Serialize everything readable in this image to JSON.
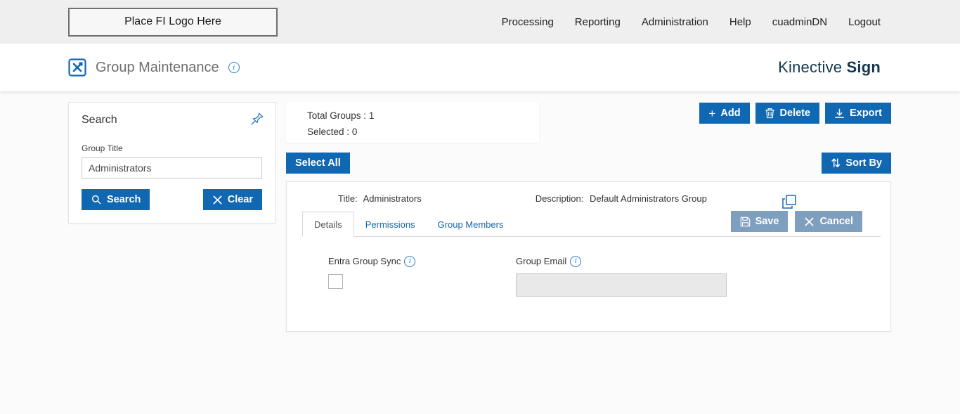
{
  "topbar": {
    "logo_placeholder": "Place FI Logo Here",
    "nav": [
      {
        "label": "Processing"
      },
      {
        "label": "Reporting"
      },
      {
        "label": "Administration"
      },
      {
        "label": "Help"
      },
      {
        "label": "cuadminDN"
      },
      {
        "label": "Logout"
      }
    ]
  },
  "header": {
    "title": "Group Maintenance",
    "brand_regular": "Kinective ",
    "brand_bold": "Sign"
  },
  "search_panel": {
    "title": "Search",
    "group_title_label": "Group Title",
    "group_title_value": "Administrators",
    "search_button": "Search",
    "clear_button": "Clear"
  },
  "summary": {
    "total_groups_label": "Total Groups :",
    "total_groups_value": "1",
    "selected_label": "Selected :",
    "selected_value": "0"
  },
  "toolbar": {
    "add": "Add",
    "delete": "Delete",
    "export": "Export",
    "select_all": "Select All",
    "sort_by": "Sort By"
  },
  "group_card": {
    "title_label": "Title:",
    "title_value": "Administrators",
    "description_label": "Description:",
    "description_value": "Default Administrators Group",
    "tabs": [
      {
        "label": "Details"
      },
      {
        "label": "Permissions"
      },
      {
        "label": "Group Members"
      }
    ],
    "active_tab": "Details",
    "save_button": "Save",
    "cancel_button": "Cancel",
    "details": {
      "entra_group_sync_label": "Entra Group Sync",
      "group_email_label": "Group Email",
      "group_email_value": ""
    }
  },
  "icons": {
    "info_glyph": "i",
    "sort_glyph": "⇅",
    "add_glyph": "+"
  },
  "colors": {
    "primary_blue": "#1168b2",
    "muted_blue": "#7f9fbe",
    "brand_navy": "#12384f"
  }
}
